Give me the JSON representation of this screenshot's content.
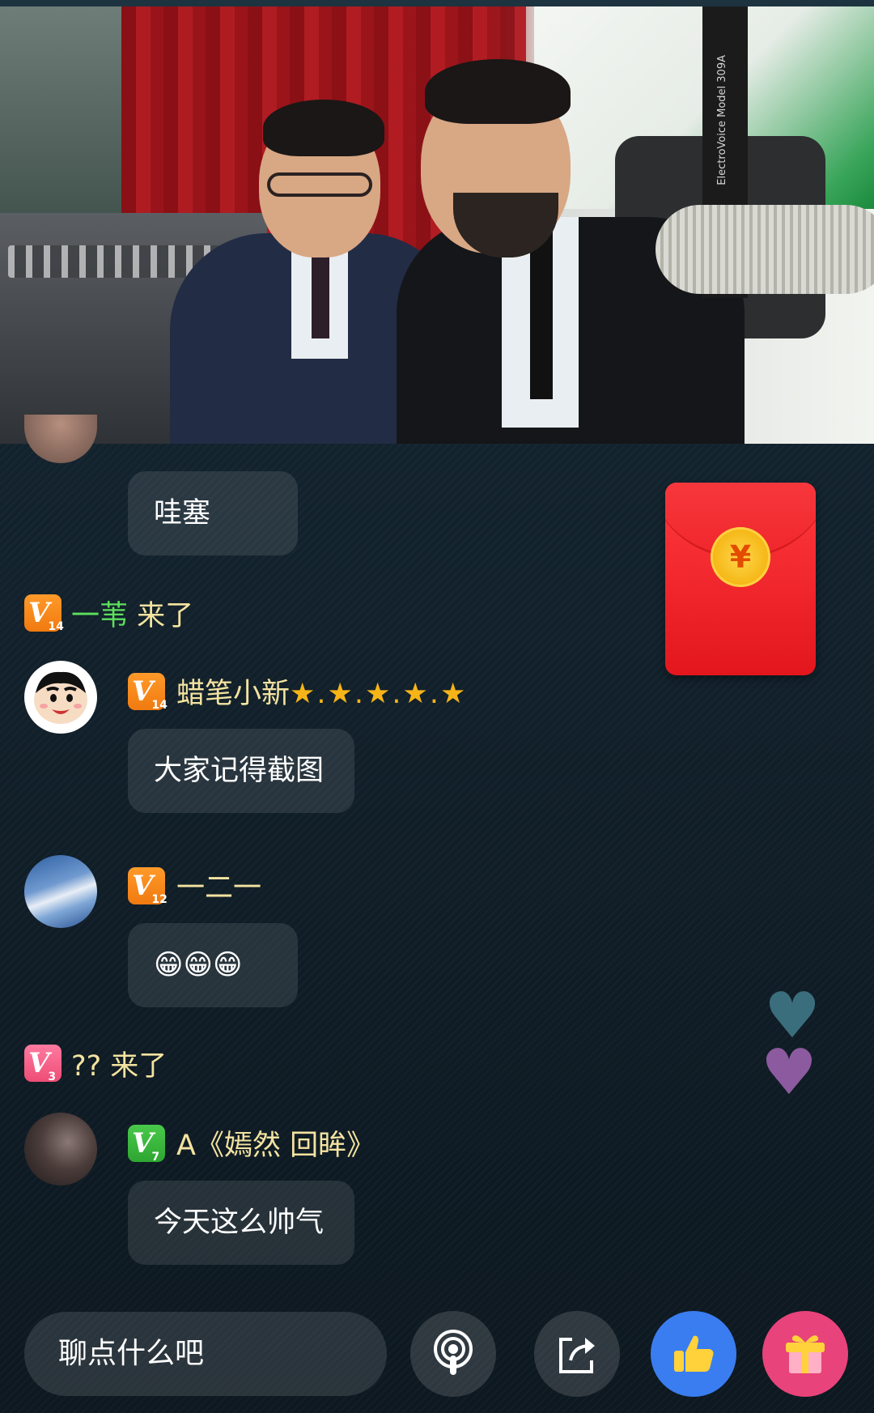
{
  "video": {
    "mic_label": "ElectroVoice Model 309A"
  },
  "chat": {
    "messages": [
      {
        "type": "message",
        "avatar": "partial-avatar",
        "text": "哇塞"
      },
      {
        "type": "entry",
        "level": "14",
        "badge_color": "#f07a10",
        "name": "一苇",
        "action": "来了"
      },
      {
        "type": "message",
        "avatar": "crayon-shinchan-avatar",
        "level": "14",
        "badge_color": "#f07a10",
        "name": "蜡笔小新",
        "decoration": "★.★.★.★.★",
        "text": "大家记得截图"
      },
      {
        "type": "message",
        "avatar": "sky-avatar",
        "level": "12",
        "badge_color": "#f07a10",
        "name": "一二一",
        "text": "😁😁😁"
      },
      {
        "type": "entry",
        "level": "3",
        "badge_color": "#ee4d76",
        "name": "??",
        "action": "来了"
      },
      {
        "type": "message",
        "avatar": "portrait-avatar",
        "level": "7",
        "badge_color": "#2ea632",
        "name": "A《嫣然 回眸》",
        "text": "今天这么帅气"
      }
    ],
    "badge_letter": "V"
  },
  "red_packet": {
    "symbol": "¥",
    "color": "#e3161d"
  },
  "floating_hearts": [
    "#3b6e7c",
    "#8c5a9f"
  ],
  "bottom_bar": {
    "input_placeholder": "聊点什么吧",
    "buttons": [
      "podcast-icon",
      "share-icon",
      "thumbs-up-icon",
      "gift-icon"
    ]
  }
}
